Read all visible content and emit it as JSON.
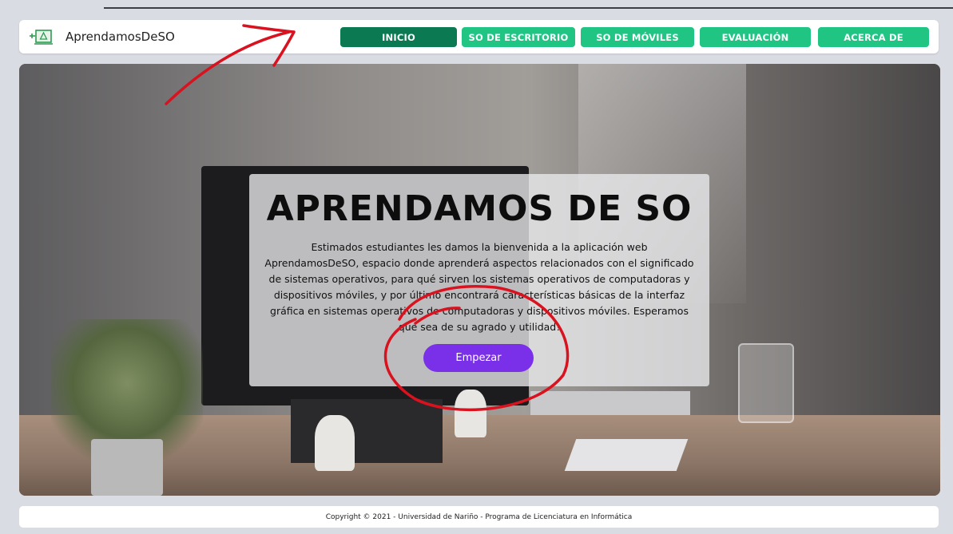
{
  "brand": {
    "name": "AprendamosDeSO",
    "logo_icon": "presentation-board-icon"
  },
  "nav": {
    "items": [
      {
        "label": "INICIO",
        "active": true
      },
      {
        "label": "SO DE ESCRITORIO",
        "active": false
      },
      {
        "label": "SO DE MÓVILES",
        "active": false
      },
      {
        "label": "EVALUACIÓN",
        "active": false
      },
      {
        "label": "ACERCA DE",
        "active": false
      }
    ]
  },
  "hero": {
    "title": "APRENDAMOS DE SO",
    "description": "Estimados estudiantes les damos la bienvenida a la aplicación web AprendamosDeSO, espacio donde aprenderá aspectos relacionados con el significado de sistemas operativos, para qué sirven los sistemas operativos de computadoras y dispositivos móviles, y por último encontrará características básicas de la interfaz gráfica en sistemas operativos de computadoras y dispositivos móviles. Esperamos que sea de su agrado y utilidad!",
    "start_label": "Empezar"
  },
  "footer": {
    "text": "Copyright © 2021 - Universidad de Nariño - Programa de Licenciatura en Informática"
  },
  "colors": {
    "nav_active": "#0b7a52",
    "nav_normal": "#20c483",
    "start_button": "#7a2fe8",
    "annotation": "#d9121f"
  }
}
